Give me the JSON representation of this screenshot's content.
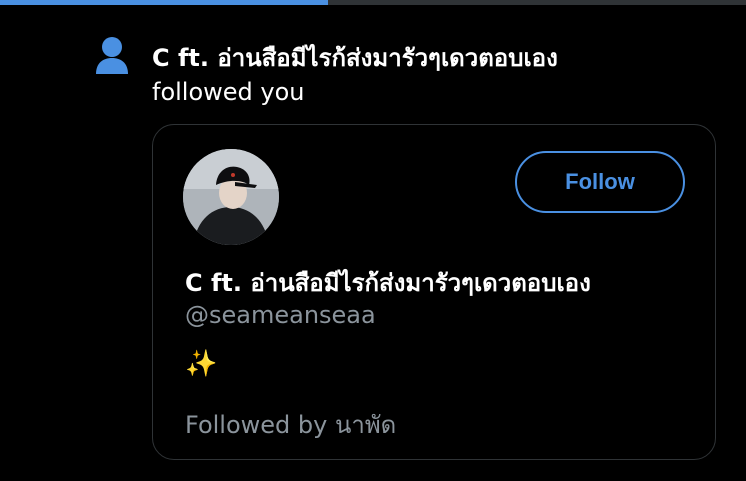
{
  "story_progress": {
    "fraction": 0.44,
    "fill_color": "#4a90e2",
    "track_color": "#2f3336"
  },
  "notification": {
    "icon": "person-icon",
    "icon_color": "#4a90e2",
    "user_name": "C ft. อ่านสือมีไรก้ส่งมารัวๆเดวตอบเอง",
    "action_text": "followed you"
  },
  "profile_card": {
    "avatar": "profile-photo",
    "follow_button_label": "Follow",
    "accent_color": "#4a90e2",
    "display_name": "C ft. อ่านสือมีไรก้ส่งมารัวๆเดวตอบเอง",
    "handle": "@seameanseaa",
    "bio": "✨",
    "followed_by_text": "Followed by นาพัด"
  }
}
